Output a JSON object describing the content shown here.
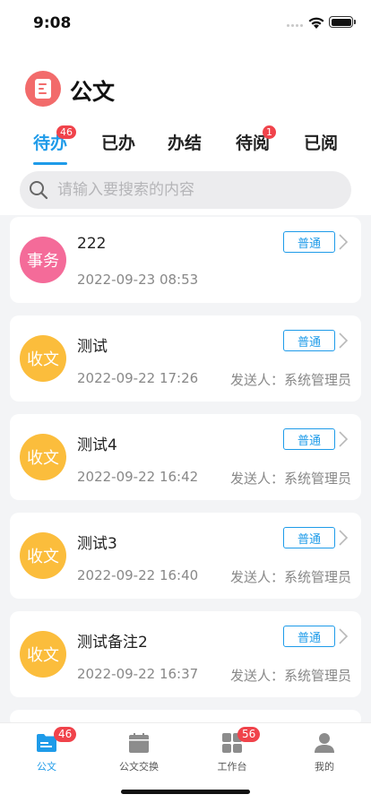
{
  "status_bar": {
    "time": "9:08"
  },
  "header": {
    "title": "公文"
  },
  "tabs": [
    {
      "label": "待办",
      "badge": "46",
      "active": true
    },
    {
      "label": "已办",
      "badge": "",
      "active": false
    },
    {
      "label": "办结",
      "badge": "",
      "active": false
    },
    {
      "label": "待阅",
      "badge": "1",
      "active": false
    },
    {
      "label": "已阅",
      "badge": "",
      "active": false
    }
  ],
  "search": {
    "placeholder": "请输入要搜索的内容",
    "value": ""
  },
  "items": [
    {
      "avatar_text": "事务",
      "avatar_color": "#f46b99",
      "title": "222",
      "date": "2022-09-23 08:53",
      "sender": "",
      "priority": "普通"
    },
    {
      "avatar_text": "收文",
      "avatar_color": "#fbbd3c",
      "title": "测试",
      "date": "2022-09-22 17:26",
      "sender": "发送人：系统管理员",
      "priority": "普通"
    },
    {
      "avatar_text": "收文",
      "avatar_color": "#fbbd3c",
      "title": "测试4",
      "date": "2022-09-22 16:42",
      "sender": "发送人：系统管理员",
      "priority": "普通"
    },
    {
      "avatar_text": "收文",
      "avatar_color": "#fbbd3c",
      "title": "测试3",
      "date": "2022-09-22 16:40",
      "sender": "发送人：系统管理员",
      "priority": "普通"
    },
    {
      "avatar_text": "收文",
      "avatar_color": "#fbbd3c",
      "title": "测试备注2",
      "date": "2022-09-22 16:37",
      "sender": "发送人：系统管理员",
      "priority": "普通"
    }
  ],
  "tabbar": [
    {
      "label": "公文",
      "icon": "folder-icon",
      "badge": "46",
      "active": true
    },
    {
      "label": "公文交换",
      "icon": "calendar-icon",
      "badge": "",
      "active": false
    },
    {
      "label": "工作台",
      "icon": "grid-icon",
      "badge": "56",
      "active": false
    },
    {
      "label": "我的",
      "icon": "user-icon",
      "badge": "",
      "active": false
    }
  ],
  "colors": {
    "accent": "#1e9be9",
    "badge": "#f0434b",
    "logo": "#f26b6b"
  }
}
